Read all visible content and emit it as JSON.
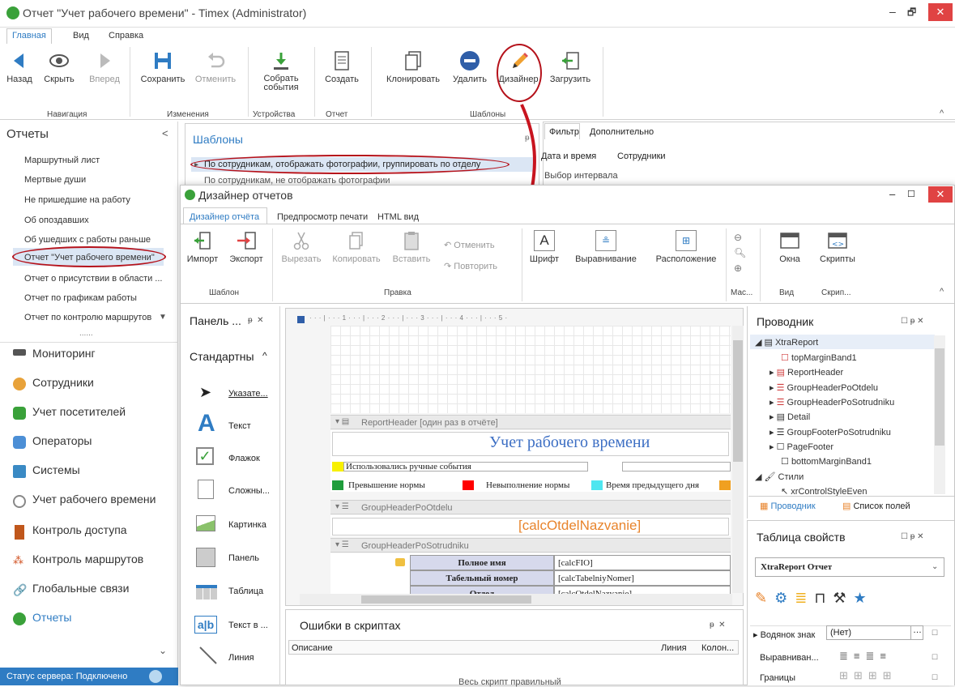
{
  "window": {
    "title": "Отчет \"Учет рабочего времени\" - Timex (Administrator)",
    "min": "–",
    "max": "🗗",
    "close": "✕"
  },
  "menu": [
    "Главная",
    "Вид",
    "Справка"
  ],
  "ribbon": {
    "buttons": [
      {
        "label": "Назад"
      },
      {
        "label": "Скрыть"
      },
      {
        "label": "Вперед"
      },
      {
        "label": "Сохранить"
      },
      {
        "label": "Отменить"
      },
      {
        "label": "Собрать события"
      },
      {
        "label": "Создать"
      },
      {
        "label": "Клонировать"
      },
      {
        "label": "Удалить"
      },
      {
        "label": "Дизайнер"
      },
      {
        "label": "Загрузить"
      }
    ],
    "groups": [
      "Навигация",
      "Изменения",
      "Устройства",
      "Отчет",
      "Шаблоны"
    ]
  },
  "nav": {
    "header": "Отчеты",
    "reports": [
      "Маршрутный лист",
      "Мертвые души",
      "Не пришедшие на работу",
      "Об опоздавших",
      "Об ушедших с работы раньше",
      "Отчет \"Учет рабочего времени\"",
      "Отчет о присутствии в области ...",
      "Отчет по графикам работы",
      "Отчет по контролю маршрутов"
    ],
    "more": "......",
    "modules": [
      "Мониторинг",
      "Сотрудники",
      "Учет посетителей",
      "Операторы",
      "Системы",
      "Учет рабочего времени",
      "Контроль доступа",
      "Контроль маршрутов",
      "Глобальные связи",
      "Отчеты"
    ],
    "status": "Статус сервера: Подключено"
  },
  "templates": {
    "title": "Шаблоны",
    "pin": "ᵽ",
    "rows": [
      "По сотрудникам, отображать фотографии, группировать по отделу",
      "По сотрудникам, не отображать фотографии"
    ]
  },
  "filter": {
    "tabs": [
      "Фильтр",
      "Дополнительно"
    ],
    "subtabs": [
      "Дата и время",
      "Сотрудники"
    ],
    "group": "Выбор интервала"
  },
  "designer": {
    "title": "Дизайнер отчетов",
    "tabs": [
      "Дизайнер отчёта",
      "Предпросмотр печати",
      "HTML вид"
    ],
    "buttons": [
      "Импорт",
      "Экспорт",
      "Вырезать",
      "Копировать",
      "Вставить",
      "Отменить",
      "Повторить",
      "Шрифт",
      "Выравнивание",
      "Расположение",
      "Окна",
      "Скрипты"
    ],
    "groups": [
      "Шаблон",
      "Правка",
      "Мас...",
      "Вид",
      "Скрип..."
    ],
    "toolbox": {
      "title": "Панель ...",
      "section": "Стандартны",
      "items": [
        "Указате...",
        "Текст",
        "Флажок",
        "Сложны...",
        "Картинка",
        "Панель",
        "Таблица",
        "Текст в ...",
        "Линия"
      ]
    },
    "ruler": "· · · | · · · 1 · · · | · · · 2 · · · | · · · 3 · · · | · · · 4 · · · | · · · 5 ·",
    "bands": {
      "report_header": "ReportHeader [один раз в отчёте]",
      "report_title": "Учет рабочего времени",
      "manual": "Использовались ручные события",
      "legend": [
        "Превышение нормы",
        "Невыполнение нормы",
        "Время предыдущего дня"
      ],
      "gh_otdel": "GroupHeaderPoOtdelu",
      "otdel_field": "[calcOtdelNazvanie]",
      "gh_sotr": "GroupHeaderPoSotrudniku",
      "fields": [
        [
          "Полное имя",
          "[calcFIO]"
        ],
        [
          "Табельный номер",
          "[calcTabelniyNomer]"
        ],
        [
          "Отдел",
          "[calcOtdelNazvanie]"
        ]
      ]
    },
    "errors": {
      "title": "Ошибки в скриптах",
      "cols": [
        "Описание",
        "Линия",
        "Колон..."
      ],
      "ok": "Весь скрипт правильный"
    },
    "explorer": {
      "title": "Проводник",
      "items": [
        "XtraReport",
        "topMarginBand1",
        "ReportHeader",
        "GroupHeaderPoOtdelu",
        "GroupHeaderPoSotrudniku",
        "Detail",
        "GroupFooterPoSotrudniku",
        "PageFooter",
        "bottomMarginBand1",
        "Стили",
        "xrControlStyleEven"
      ],
      "tabs": [
        "Проводник",
        "Список полей"
      ]
    },
    "props": {
      "title": "Таблица свойств",
      "selected": "XtraReport  Отчет",
      "rows": [
        [
          "Водянок знак",
          "(Нет)"
        ],
        [
          "Выравниван...",
          ""
        ],
        [
          "Границы",
          ""
        ]
      ]
    }
  },
  "colors": {
    "accent": "#2f7cc3",
    "highlight": "#b5121b",
    "title_blue": "#3d6fc4",
    "orange": "#e8842c"
  }
}
